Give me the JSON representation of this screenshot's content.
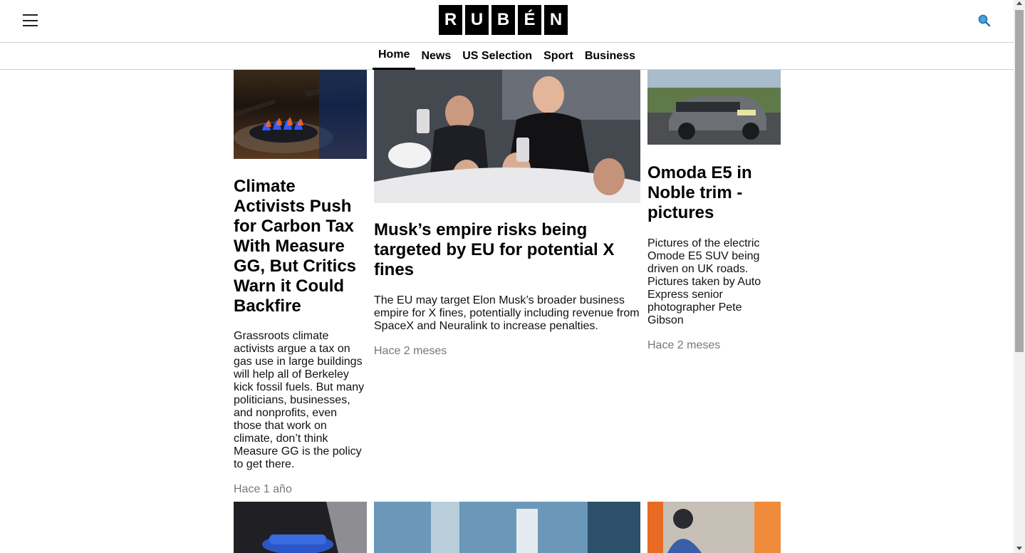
{
  "header": {
    "menu_icon": "hamburger-icon",
    "logo_letters": [
      "R",
      "U",
      "B",
      "É",
      "N"
    ],
    "search_icon": "search-icon"
  },
  "nav": {
    "items": [
      {
        "label": "Home",
        "active": true
      },
      {
        "label": "News",
        "active": false
      },
      {
        "label": "US Selection",
        "active": false
      },
      {
        "label": "Sport",
        "active": false
      },
      {
        "label": "Business",
        "active": false
      }
    ]
  },
  "articles": [
    {
      "title": "Climate Activists Push for Carbon Tax With Measure GG, But Critics Warn it Could Backfire",
      "summary": "Grassroots climate activists argue a tax on gas use in large buildings will help all of Berkeley kick fossil fuels. But many politicians, businesses, and nonprofits, even those that work on climate, don’t think Measure GG is the policy to get there.",
      "time": "Hace 1 año"
    },
    {
      "title": "Musk’s empire risks being targeted by EU for potential X fines",
      "summary": "The EU may target Elon Musk’s broader business empire for X fines, potentially including revenue from SpaceX and Neuralink to increase penalties.",
      "time": "Hace 2 meses"
    },
    {
      "title": "Omoda E5 in Noble trim - pictures",
      "summary": "Pictures of the electric Omode E5 SUV being driven on UK roads. Pictures taken by Auto Express senior photographer Pete Gibson",
      "time": "Hace 2 meses"
    }
  ]
}
